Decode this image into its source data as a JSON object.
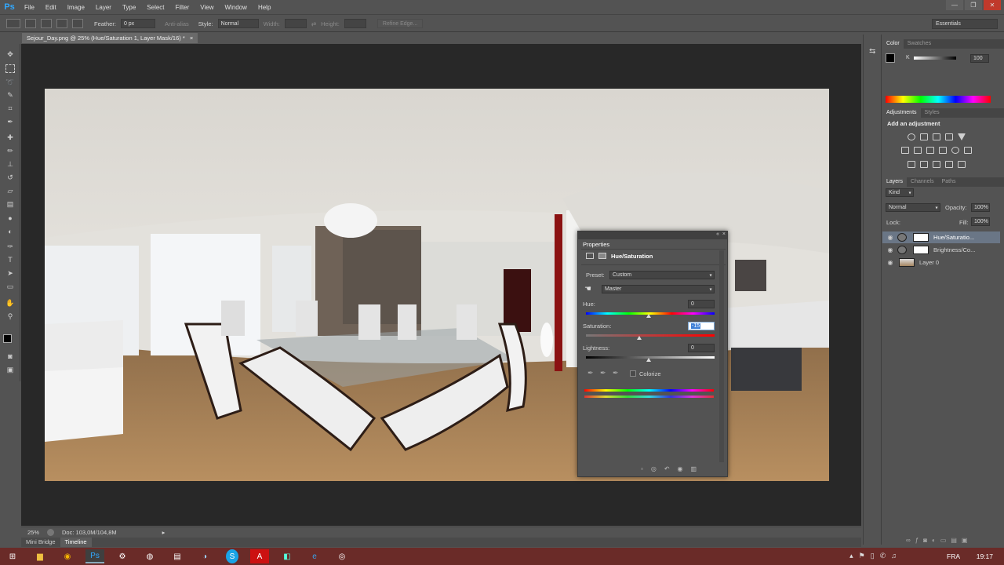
{
  "app": {
    "logo": "Ps"
  },
  "menu": [
    "File",
    "Edit",
    "Image",
    "Layer",
    "Type",
    "Select",
    "Filter",
    "View",
    "Window",
    "Help"
  ],
  "window_controls": [
    "—",
    "❐",
    "✕"
  ],
  "options": {
    "feather_label": "Feather:",
    "feather_value": "0 px",
    "antialias_label": "Anti-alias",
    "style_label": "Style:",
    "style_value": "Normal",
    "width_label": "Width:",
    "height_label": "Height:",
    "refine_edge": "Refine Edge...",
    "workspace": "Essentials"
  },
  "document": {
    "tab_title": "Sejour_Day.png @ 25% (Hue/Saturation 1, Layer Mask/16) *",
    "tab_close": "×"
  },
  "status": {
    "zoom": "25%",
    "doc": "Doc: 103,0M/104,8M"
  },
  "bottom_tabs": [
    "Mini Bridge",
    "Timeline"
  ],
  "color_panel": {
    "tabs": [
      "Color",
      "Swatches"
    ],
    "channel": "K",
    "value": "100"
  },
  "adjustments_panel": {
    "tabs": [
      "Adjustments",
      "Styles"
    ],
    "heading": "Add an adjustment"
  },
  "layers_panel": {
    "tabs": [
      "Layers",
      "Channels",
      "Paths"
    ],
    "kind": "Kind",
    "blend_mode": "Normal",
    "opacity_label": "Opacity:",
    "opacity": "100%",
    "lock_label": "Lock:",
    "fill_label": "Fill:",
    "fill": "100%",
    "layers": [
      {
        "name": "Hue/Saturatio..."
      },
      {
        "name": "Brightness/Co..."
      },
      {
        "name": "Layer 0"
      }
    ]
  },
  "properties": {
    "title": "Properties",
    "adjustment": "Hue/Saturation",
    "preset_label": "Preset:",
    "preset_value": "Custom",
    "channel_value": "Master",
    "hue_label": "Hue:",
    "hue_value": "0",
    "saturation_label": "Saturation:",
    "saturation_value": "-15",
    "lightness_label": "Lightness:",
    "lightness_value": "0",
    "colorize_label": "Colorize"
  },
  "taskbar": {
    "language": "FRA",
    "time": "19:17"
  },
  "colors": {
    "accent": "#31a8ff",
    "taskbar": "#6a2b28",
    "canvas_bg": "#282828"
  }
}
